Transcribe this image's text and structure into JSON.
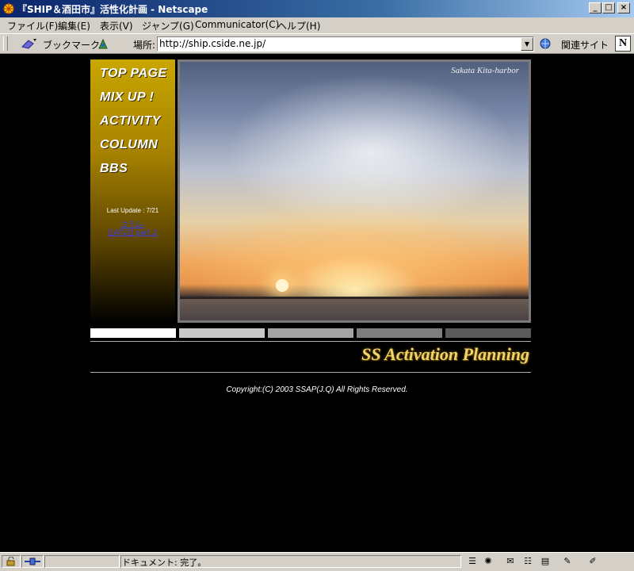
{
  "window": {
    "title": "『SHIP＆酒田市』活性化計画 - Netscape",
    "minimize": "_",
    "maximize": "□",
    "close": "×"
  },
  "menu": {
    "items": [
      "ファイル(F)",
      "編集(E)",
      "表示(V)",
      "ジャンプ(G)",
      "Communicator(C)",
      "ヘルプ(H)"
    ]
  },
  "toolbar": {
    "bookmarks_label": "ブックマーク",
    "location_label": "場所:",
    "url": "http://ship.cside.ne.jp/",
    "related_label": "関連サイト",
    "netscape_logo": "N"
  },
  "page": {
    "nav": [
      "TOP PAGE",
      "MIX UP !",
      "ACTIVITY",
      "COLUMN",
      "BBS"
    ],
    "last_update": "Last Update : 7/21",
    "update_link_1": "コラム-",
    "update_link_2": "[[ATU]] part 2",
    "photo_caption": "Sakata Kita-harbor",
    "brand": "SS Activation Planning",
    "copyright": "Copyright:(C) 2003 SSAP(J.Q) All Rights Reserved.",
    "stripe_colors": [
      "#ffffff",
      "#c8c8c8",
      "#a4a4a4",
      "#7e7e7e",
      "#5a5a5a"
    ]
  },
  "status": {
    "text": "ドキュメント: 完了。"
  }
}
